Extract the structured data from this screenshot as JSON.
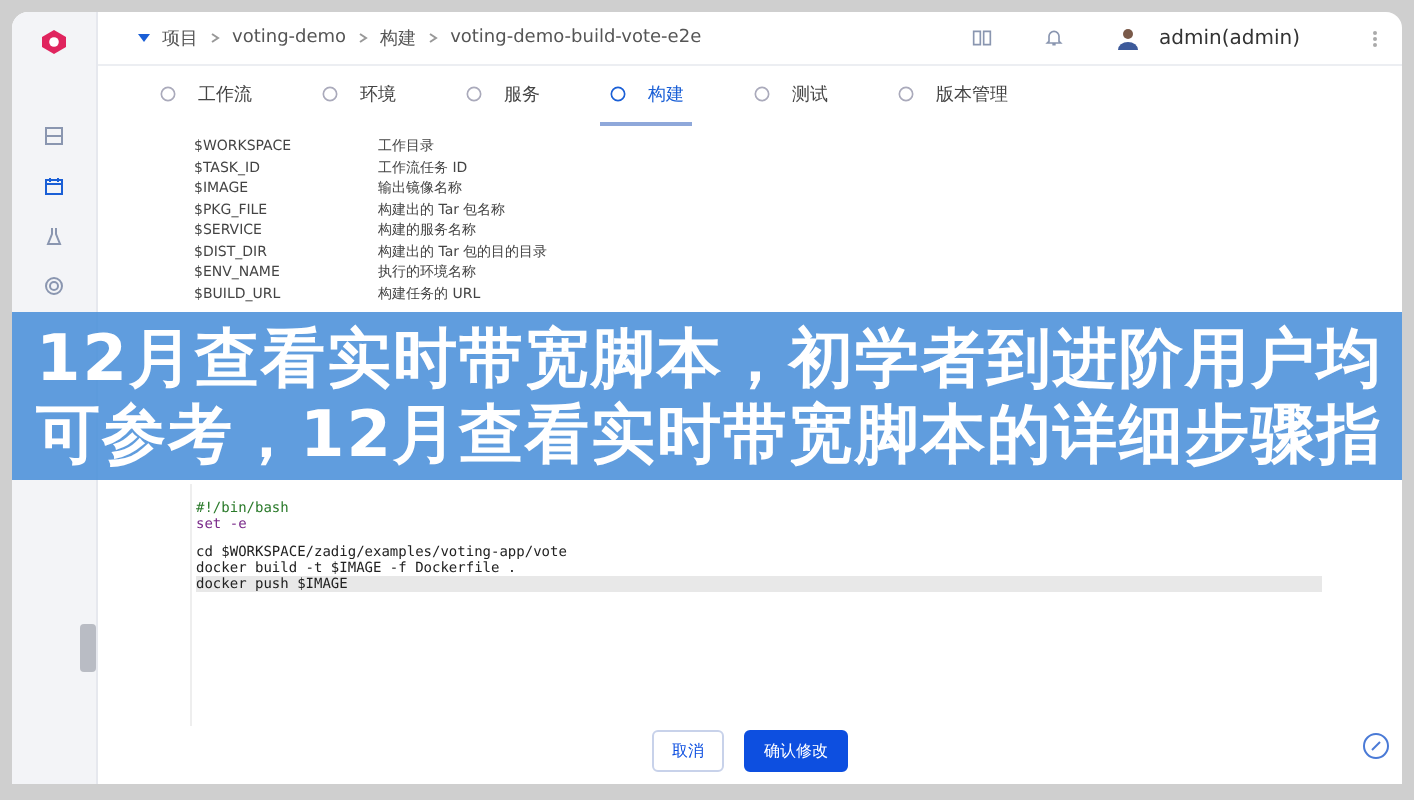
{
  "breadcrumb": [
    {
      "label": "项目"
    },
    {
      "label": "voting-demo"
    },
    {
      "label": "构建"
    },
    {
      "label": "voting-demo-build-vote-e2e"
    }
  ],
  "user": {
    "name": "admin(admin)"
  },
  "tabs": [
    {
      "label": "工作流",
      "selected": false
    },
    {
      "label": "环境",
      "selected": false
    },
    {
      "label": "服务",
      "selected": false
    },
    {
      "label": "构建",
      "selected": true
    },
    {
      "label": "测试",
      "selected": false
    },
    {
      "label": "版本管理",
      "selected": false
    }
  ],
  "variables": [
    {
      "name": "$WORKSPACE",
      "description": "工作目录"
    },
    {
      "name": "$TASK_ID",
      "description": "工作流任务 ID"
    },
    {
      "name": "$IMAGE",
      "description": "输出镜像名称"
    },
    {
      "name": "$PKG_FILE",
      "description": "构建出的 Tar 包名称"
    },
    {
      "name": "$SERVICE",
      "description": "构建的服务名称"
    },
    {
      "name": "$DIST_DIR",
      "description": "构建出的 Tar 包的目的目录"
    },
    {
      "name": "$ENV_NAME",
      "description": "执行的环境名称"
    },
    {
      "name": "$BUILD_URL",
      "description": "构建任务的 URL"
    }
  ],
  "script_blocks": [
    [
      {
        "text": "#!/bin/bash",
        "kind": "comment",
        "highlighted": false
      },
      {
        "text": "set -e",
        "kind": "keyword",
        "highlighted": false
      }
    ],
    [
      {
        "text": "cd $WORKSPACE/zadig/examples/voting-app/vote",
        "kind": "plain",
        "highlighted": false
      },
      {
        "text": "docker build -t $IMAGE -f Dockerfile .",
        "kind": "plain",
        "highlighted": false
      },
      {
        "text": "docker push $IMAGE",
        "kind": "plain",
        "highlighted": true
      }
    ]
  ],
  "buttons": [
    {
      "label": "取消",
      "kind": "secondary"
    },
    {
      "label": "确认修改",
      "kind": "primary"
    }
  ],
  "banner": {
    "title": "12月查看实时带宽脚本，初学者到进阶用户均可参考，12月查看实时带宽脚本的详细步骤指"
  }
}
